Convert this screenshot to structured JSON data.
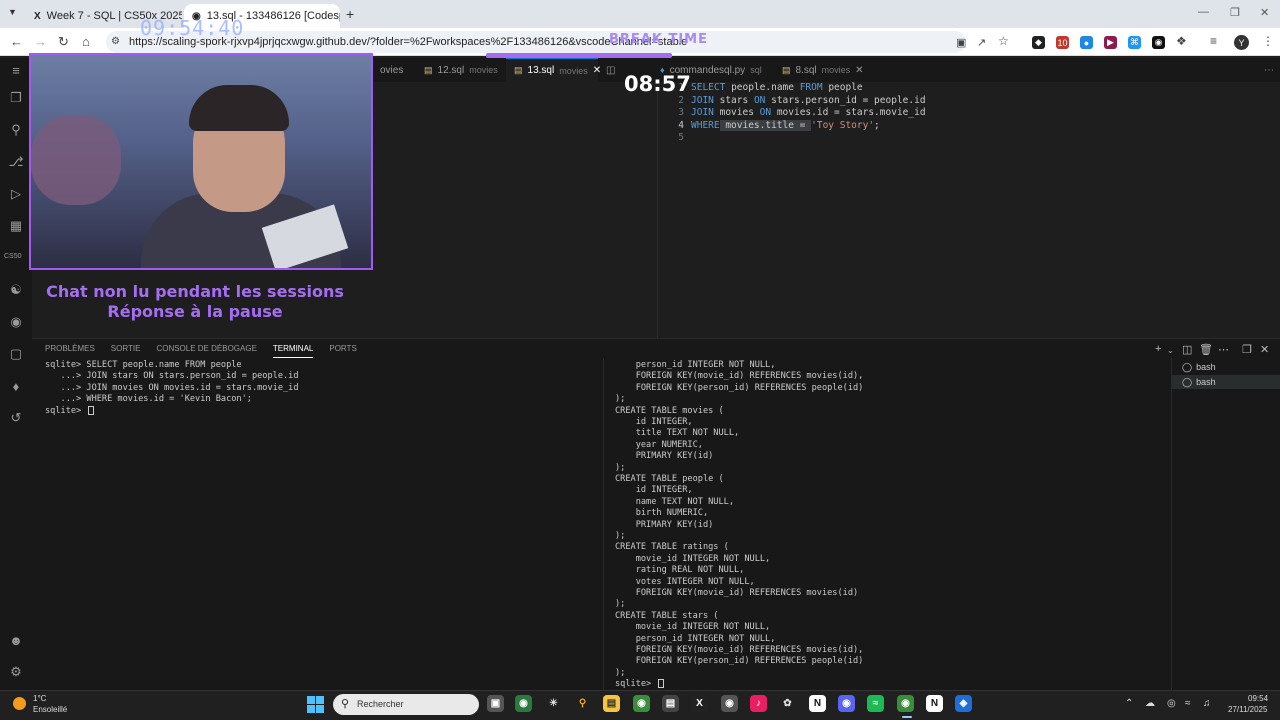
{
  "browser": {
    "tabs": [
      {
        "title": "Week 7 - SQL | CS50x 2025 ? |",
        "favicon": "x-icon"
      },
      {
        "title": "13.sql - 133486126 [Codespace",
        "favicon": "github-icon"
      }
    ],
    "url": "https://scaling-spork-rjxvp4jprjqcxwgw.github.dev/?folder=%2Fworkspaces%2F133486126&vscodeChannel=stable",
    "profile_initial": "Y",
    "extension_badge": "10"
  },
  "overlay": {
    "clock": "09:54:40",
    "break_label": "BREAK TIME",
    "break_timer": "08:57",
    "chat_line1": "Chat non lu pendant les sessions",
    "chat_line2": "Réponse à la pause"
  },
  "activity_bar": {
    "cs50_label": "CS50"
  },
  "editor": {
    "tabs": [
      {
        "name": "ovies",
        "sub": ""
      },
      {
        "name": "12.sql",
        "sub": "movies"
      },
      {
        "name": "13.sql",
        "sub": "movies",
        "active": true
      },
      {
        "name": "commandesql.py",
        "sub": "sql"
      },
      {
        "name": "8.sql",
        "sub": "movies"
      }
    ],
    "lines": [
      {
        "n": "1",
        "parts": [
          [
            "kw",
            "SELECT"
          ],
          [
            "",
            "people.name "
          ],
          [
            "kw",
            "FROM"
          ],
          [
            "",
            " people"
          ]
        ]
      },
      {
        "n": "2",
        "parts": [
          [
            "kw",
            "JOIN"
          ],
          [
            "",
            " stars "
          ],
          [
            "kw",
            "ON"
          ],
          [
            "",
            " stars.person_id = people.id"
          ]
        ]
      },
      {
        "n": "3",
        "parts": [
          [
            "kw",
            "JOIN"
          ],
          [
            "",
            " movies "
          ],
          [
            "kw",
            "ON"
          ],
          [
            "",
            " movies.id = stars.movie_id"
          ]
        ]
      },
      {
        "n": "4",
        "parts": [
          [
            "kw",
            "WHERE"
          ],
          [
            "sel",
            " movies.title = "
          ],
          [
            "str",
            "'Toy Story'"
          ],
          [
            "",
            ";"
          ]
        ]
      },
      {
        "n": "5",
        "parts": []
      }
    ]
  },
  "panel": {
    "tabs": [
      "PROBLÈMES",
      "SORTIE",
      "CONSOLE DE DÉBOGAGE",
      "TERMINAL",
      "PORTS"
    ],
    "active_tab": "TERMINAL",
    "terminal_left": [
      "sqlite> SELECT people.name FROM people",
      "   ...> JOIN stars ON stars.person_id = people.id",
      "   ...> JOIN movies ON movies.id = stars.movie_id",
      "   ...> WHERE movies.id = 'Kevin Bacon';",
      "sqlite> "
    ],
    "terminal_right": [
      "    person_id INTEGER NOT NULL,",
      "    FOREIGN KEY(movie_id) REFERENCES movies(id),",
      "    FOREIGN KEY(person_id) REFERENCES people(id)",
      ");",
      "CREATE TABLE movies (",
      "    id INTEGER,",
      "    title TEXT NOT NULL,",
      "    year NUMERIC,",
      "    PRIMARY KEY(id)",
      ");",
      "CREATE TABLE people (",
      "    id INTEGER,",
      "    name TEXT NOT NULL,",
      "    birth NUMERIC,",
      "    PRIMARY KEY(id)",
      ");",
      "CREATE TABLE ratings (",
      "    movie_id INTEGER NOT NULL,",
      "    rating REAL NOT NULL,",
      "    votes INTEGER NOT NULL,",
      "    FOREIGN KEY(movie_id) REFERENCES movies(id)",
      ");",
      "CREATE TABLE stars (",
      "    movie_id INTEGER NOT NULL,",
      "    person_id INTEGER NOT NULL,",
      "    FOREIGN KEY(movie_id) REFERENCES movies(id),",
      "    FOREIGN KEY(person_id) REFERENCES people(id)",
      ");",
      "sqlite> "
    ],
    "terminal_list": [
      "bash",
      "bash"
    ]
  },
  "taskbar": {
    "weather_temp": "1°C",
    "weather_desc": "Ensoleillé",
    "search_placeholder": "Rechercher",
    "time": "09:54",
    "date": "27/11/2025"
  },
  "colors": {
    "accent_purple": "#a25af5",
    "vscode_bg": "#1e1e1e",
    "keyword": "#569cd6",
    "string": "#ce9178"
  }
}
